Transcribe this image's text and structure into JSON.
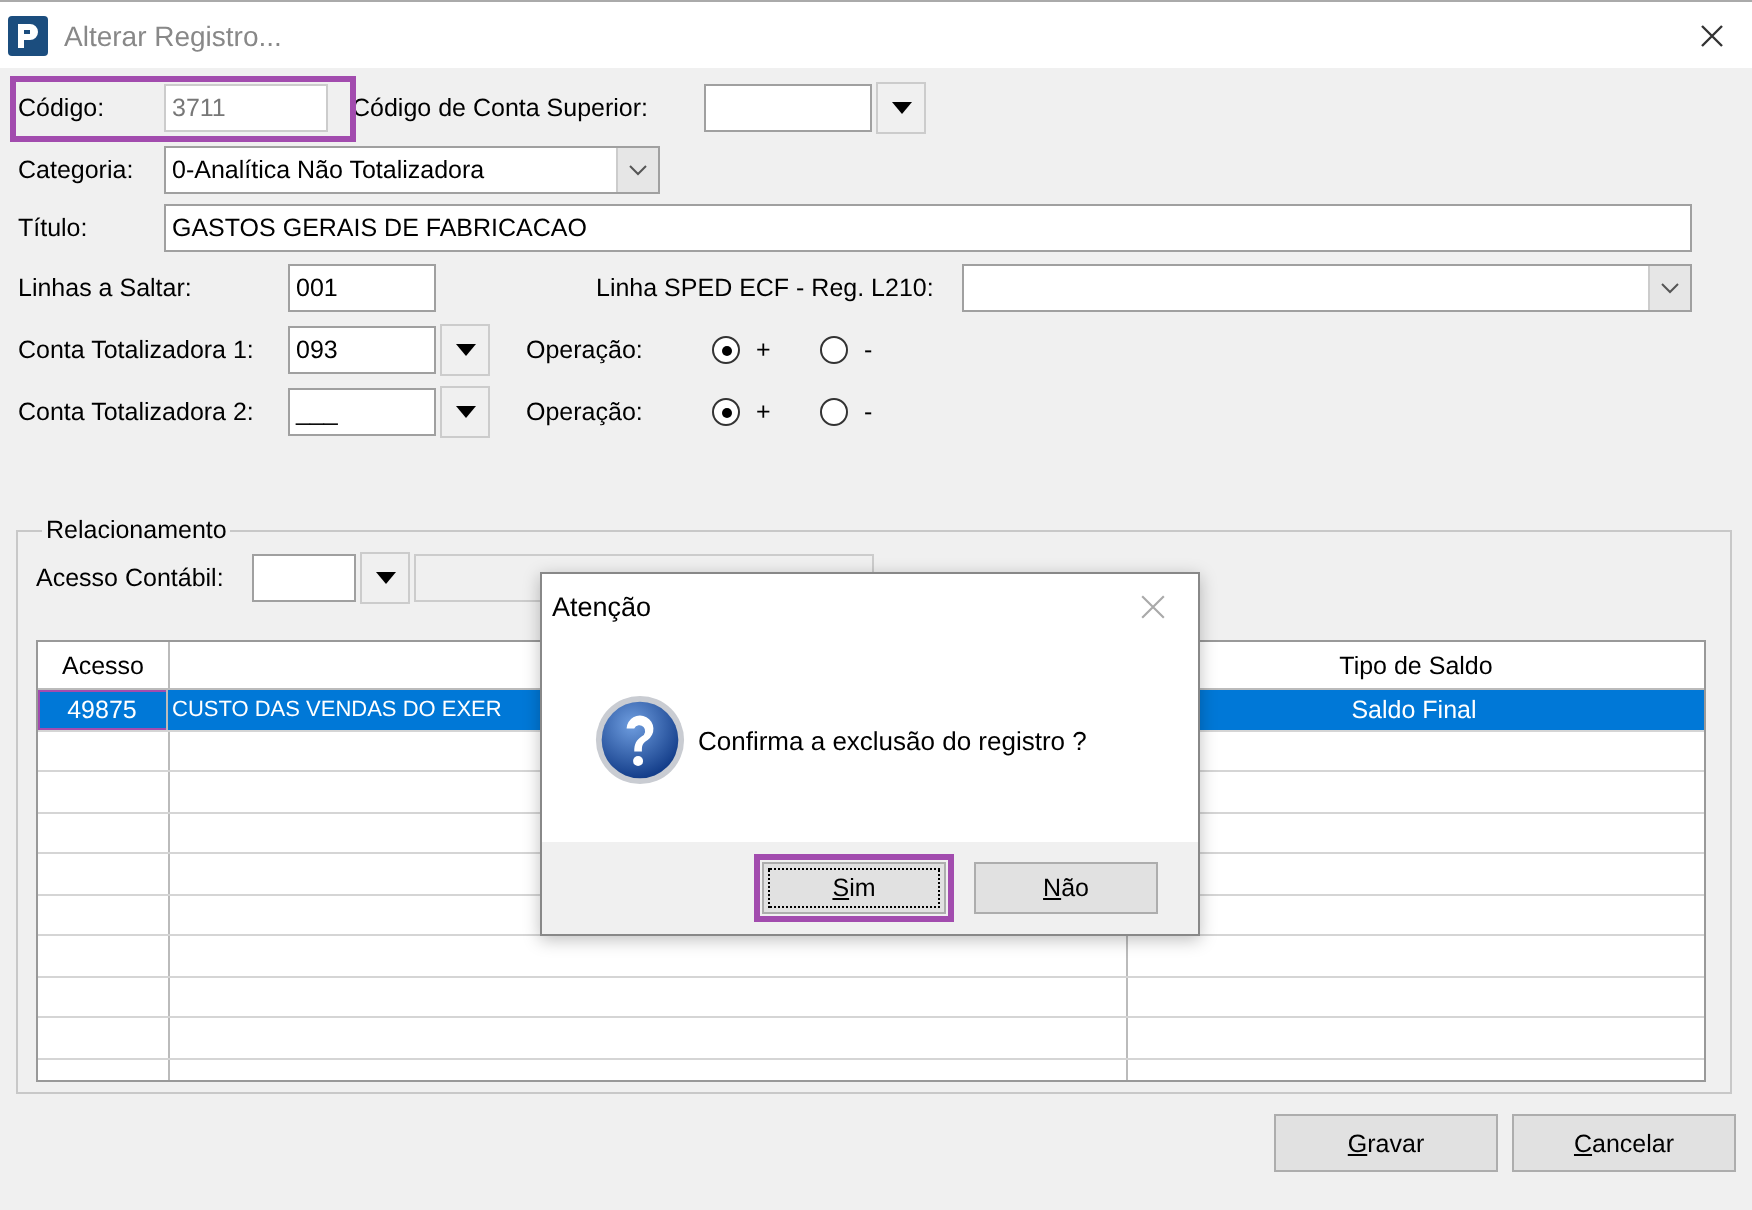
{
  "window": {
    "title": "Alterar Registro..."
  },
  "form": {
    "codigo": {
      "label": "Código:",
      "value": "3711",
      "disabled": true,
      "highlighted": true
    },
    "conta_superior": {
      "label": "Código de Conta Superior:"
    },
    "categoria": {
      "label": "Categoria:",
      "value": "0-Analítica Não Totalizadora"
    },
    "titulo": {
      "label": "Título:",
      "value": "GASTOS GERAIS DE FABRICACAO"
    },
    "linhas_saltar": {
      "label": "Linhas a Saltar:",
      "value": "001"
    },
    "linha_sped": {
      "label": "Linha SPED ECF - Reg. L210:"
    },
    "totalizadoras": [
      {
        "label": "Conta Totalizadora 1:",
        "value": "093",
        "operation_label": "Operação:",
        "options": [
          {
            "label": "+",
            "selected": true
          },
          {
            "label": "-",
            "selected": false
          }
        ]
      },
      {
        "label": "Conta Totalizadora 2:",
        "value": "___",
        "operation_label": "Operação:",
        "options": [
          {
            "label": "+",
            "selected": true
          },
          {
            "label": "-",
            "selected": false
          }
        ]
      }
    ]
  },
  "relacionamento": {
    "title": "Relacionamento",
    "acesso_contabil": {
      "label": "Acesso Contábil:"
    },
    "table": {
      "columns": [
        "Acesso",
        "Tipo de Saldo"
      ],
      "rows": [
        {
          "acesso": "49875",
          "descricao": "CUSTO DAS VENDAS DO EXER",
          "tipo": "Saldo Final",
          "selected": true,
          "highlighted": true
        },
        {
          "selected": false
        },
        {
          "selected": false
        },
        {
          "selected": false
        },
        {
          "selected": false
        },
        {
          "selected": false
        },
        {
          "selected": false
        },
        {
          "selected": false
        },
        {
          "selected": false
        },
        {
          "selected": false
        }
      ]
    }
  },
  "buttons": [
    {
      "mnemonic": "G",
      "rest": "ravar"
    },
    {
      "mnemonic": "C",
      "rest": "ancelar"
    }
  ],
  "dialog": {
    "title": "Atenção",
    "message": "Confirma a exclusão do registro ?",
    "buttons": [
      {
        "mnemonic": "S",
        "rest": "im",
        "focused": true,
        "highlighted": true
      },
      {
        "mnemonic": "N",
        "rest": "ão",
        "focused": false,
        "highlighted": false
      }
    ]
  }
}
